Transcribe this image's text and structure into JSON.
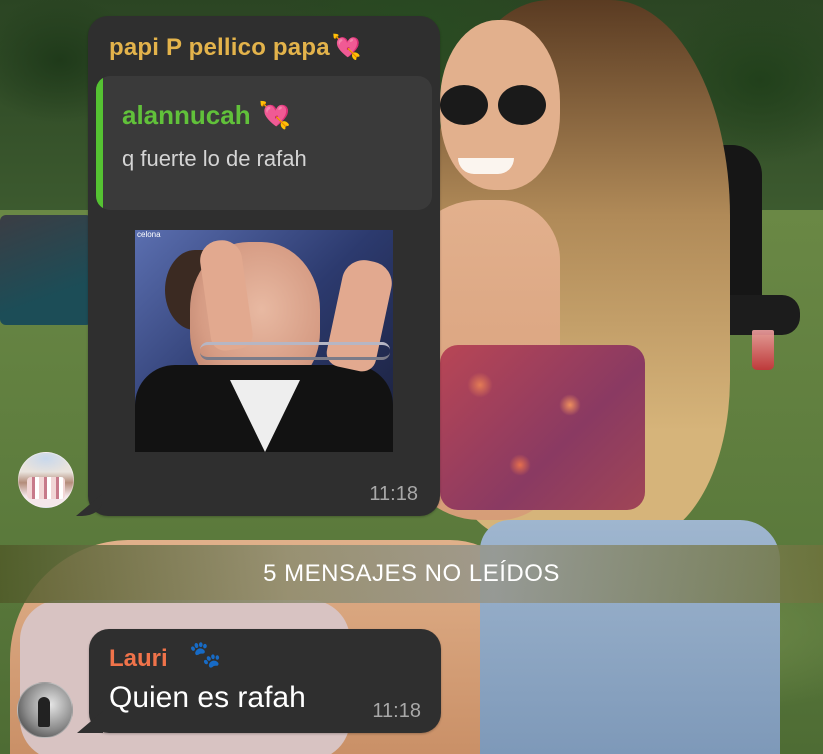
{
  "messages": [
    {
      "sender": "papi P pellico papa",
      "sender_emoji": "💘",
      "sender_color": "#e3b34b",
      "reply": {
        "name": "alannucah",
        "name_emoji": "💘",
        "name_color": "#61c13a",
        "text": "q fuerte lo de rafah"
      },
      "sticker": {
        "description_icon": "handcuffed-man-sticker",
        "channel_text": "celona"
      },
      "time": "11:18",
      "avatar_icon": "group-photo-avatar"
    },
    {
      "sender": "Lauri",
      "sender_emoji": "🐾",
      "sender_color": "#f0734a",
      "text": "Quien es rafah",
      "time": "11:18",
      "avatar_icon": "bw-photo-avatar"
    }
  ],
  "unread_banner": "5 MENSAJES NO LEÍDOS"
}
